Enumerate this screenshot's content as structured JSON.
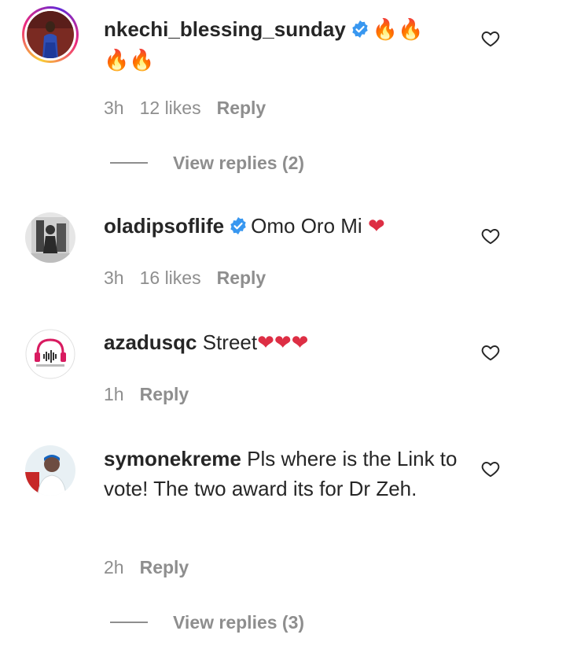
{
  "comments": [
    {
      "username": "nkechi_blessing_sunday",
      "verified": true,
      "text": "🔥🔥\n🔥🔥",
      "time": "3h",
      "likes": "12 likes",
      "reply_label": "Reply",
      "view_replies": "View replies (2)"
    },
    {
      "username": "oladipsoflife",
      "verified": true,
      "text": "Omo Oro Mi",
      "time": "3h",
      "likes": "16 likes",
      "reply_label": "Reply"
    },
    {
      "username": "azadusqc",
      "verified": false,
      "text": "Street",
      "time": "1h",
      "reply_label": "Reply"
    },
    {
      "username": "symonekreme",
      "verified": false,
      "text": "Pls where is the Link to vote! The two award its for Dr Zeh.",
      "time": "2h",
      "reply_label": "Reply",
      "view_replies": "View replies (3)"
    }
  ],
  "icons": {
    "like": "heart-outline-icon",
    "verified": "verified-badge-icon"
  },
  "colors": {
    "text": "#262626",
    "secondary": "#8e8e8e",
    "verified": "#3897f0",
    "fire": "#f4511e",
    "heart": "#dd2e44"
  }
}
